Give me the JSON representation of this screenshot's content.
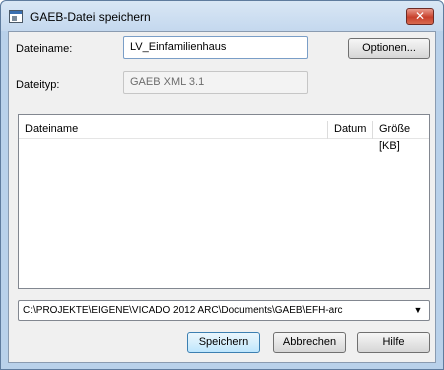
{
  "window": {
    "title": "GAEB-Datei speichern",
    "close_glyph": "✕",
    "icon": "app-window-icon"
  },
  "form": {
    "filename_label": "Dateiname:",
    "filename_value": "LV_Einfamilienhaus",
    "filetype_label": "Dateityp:",
    "filetype_value": "GAEB XML 3.1",
    "options_button": "Optionen..."
  },
  "file_list": {
    "columns": [
      "Dateiname",
      "Datum",
      "Größe [KB]"
    ],
    "rows": []
  },
  "path_combo": {
    "value": "C:\\PROJEKTE\\EIGENE\\VICADO 2012 ARC\\Documents\\GAEB\\EFH-arc",
    "arrow_glyph": "▼"
  },
  "buttons": {
    "save": "Speichern",
    "cancel": "Abbrechen",
    "help": "Hilfe"
  }
}
